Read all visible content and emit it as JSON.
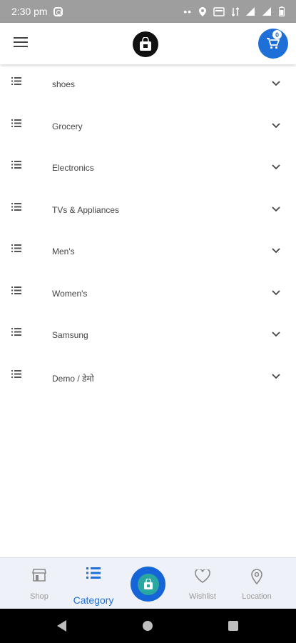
{
  "status_bar": {
    "time": "2:30 pm",
    "dots": "••"
  },
  "header": {
    "cart_count": "0"
  },
  "categories": [
    {
      "label": "shoes"
    },
    {
      "label": "Grocery"
    },
    {
      "label": "Electronics"
    },
    {
      "label": "TVs & Appliances"
    },
    {
      "label": "Men's"
    },
    {
      "label": "Women's"
    },
    {
      "label": "Samsung"
    },
    {
      "label": "Demo / डेमो"
    }
  ],
  "bottom_nav": {
    "shop": "Shop",
    "category": "Category",
    "wishlist": "Wishlist",
    "location": "Location"
  },
  "colors": {
    "accent": "#1e6fd8",
    "status_bar": "#9e9e9e"
  }
}
